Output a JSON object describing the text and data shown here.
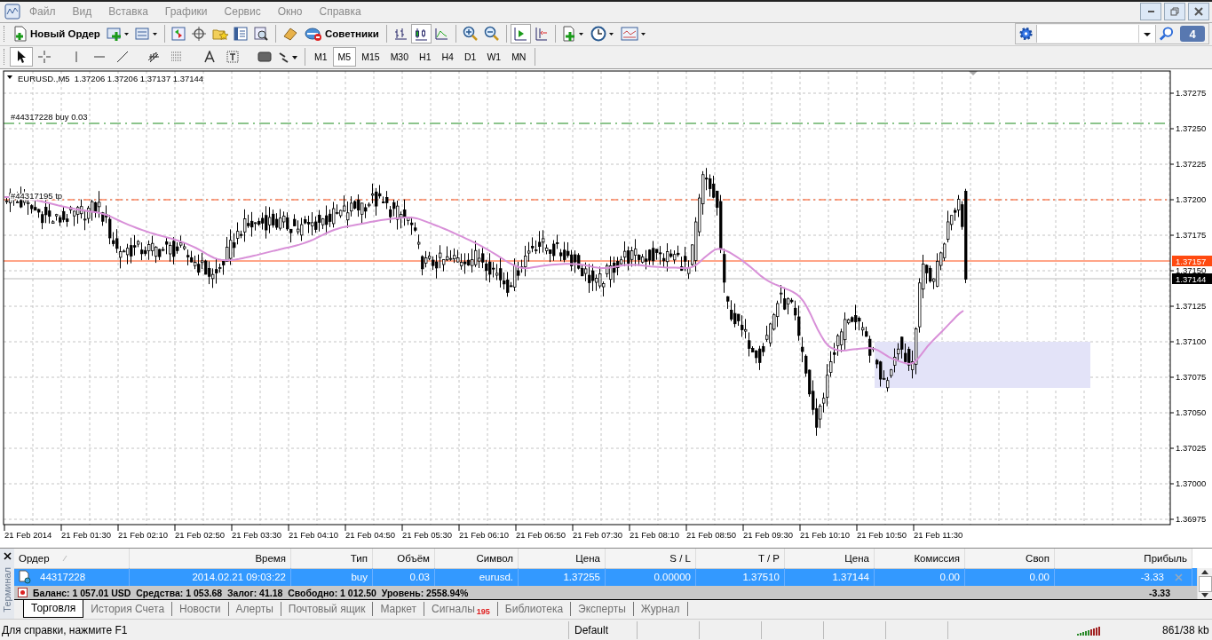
{
  "menu": [
    "Файл",
    "Вид",
    "Вставка",
    "Графики",
    "Сервис",
    "Окно",
    "Справка"
  ],
  "toolbar": {
    "new_order_label": "Новый Ордер",
    "experts_label": "Советники",
    "messages_count": "4"
  },
  "chart_types": [
    {
      "kind": "bars",
      "selected": false
    },
    {
      "kind": "candlesticks",
      "selected": true
    },
    {
      "kind": "line",
      "selected": false
    }
  ],
  "auto_scroll": {
    "on": true
  },
  "chart_shift": {
    "on": false
  },
  "tools": [
    {
      "kind": "cursor",
      "selected": true
    },
    {
      "kind": "crosshair",
      "selected": false
    },
    {
      "kind": "vertical-line",
      "selected": false
    },
    {
      "kind": "horizontal-line",
      "selected": false
    },
    {
      "kind": "trendline",
      "selected": false
    },
    {
      "kind": "channel",
      "selected": false
    },
    {
      "kind": "fibonacci",
      "selected": false
    },
    {
      "kind": "text",
      "selected": false
    },
    {
      "kind": "label",
      "selected": false
    },
    {
      "kind": "rectangle",
      "selected": false
    },
    {
      "kind": "arrows",
      "selected": false
    }
  ],
  "timeframes": [
    {
      "label": "M1",
      "selected": false
    },
    {
      "label": "M5",
      "selected": true
    },
    {
      "label": "M15",
      "selected": false
    },
    {
      "label": "M30",
      "selected": false
    },
    {
      "label": "H1",
      "selected": false
    },
    {
      "label": "H4",
      "selected": false
    },
    {
      "label": "D1",
      "selected": false
    },
    {
      "label": "W1",
      "selected": false
    },
    {
      "label": "MN",
      "selected": false
    }
  ],
  "chart": {
    "title": "EURUSD.,M5  1.37206 1.37206 1.37137 1.37144",
    "order_label": "#44317228 buy 0.03",
    "tp_label": "#44317195 tp",
    "price_axis": [
      "1.37275",
      "1.37250",
      "1.37225",
      "1.37200",
      "1.37175",
      "1.37150",
      "1.37125",
      "1.37100",
      "1.37075",
      "1.37050",
      "1.37025",
      "1.37000",
      "1.36975"
    ],
    "bid_label": "1.37157",
    "ask_label": "1.37144",
    "time_axis": [
      "21 Feb 2014",
      "21 Feb 01:30",
      "21 Feb 02:10",
      "21 Feb 02:50",
      "21 Feb 03:30",
      "21 Feb 04:10",
      "21 Feb 04:50",
      "21 Feb 05:30",
      "21 Feb 06:10",
      "21 Feb 06:50",
      "21 Feb 07:30",
      "21 Feb 08:10",
      "21 Feb 08:50",
      "21 Feb 09:30",
      "21 Feb 10:10",
      "21 Feb 10:50",
      "21 Feb 11:30"
    ]
  },
  "terminal": {
    "side_label": "Терминал",
    "columns": [
      "Ордер",
      "Время",
      "Тип",
      "Объём",
      "Символ",
      "Цена",
      "S / L",
      "T / P",
      "Цена",
      "Комиссия",
      "Своп",
      "Прибыль"
    ],
    "rows": [
      {
        "selected": true,
        "cells": [
          "44317228",
          "2014.02.21 09:03:22",
          "buy",
          "0.03",
          "eurusd.",
          "1.37255",
          "0.00000",
          "1.37510",
          "1.37144",
          "0.00",
          "0.00",
          "-3.33"
        ]
      }
    ],
    "balance": "Баланс: 1 057.01 USD  Средства: 1 053.68  Залог: 41.18  Свободно: 1 012.50  Уровень: 2558.94%",
    "total_profit": "-3.33",
    "tabs": [
      {
        "label": "Торговля",
        "selected": true
      },
      {
        "label": "История Счета",
        "selected": false
      },
      {
        "label": "Новости",
        "selected": false
      },
      {
        "label": "Алерты",
        "selected": false
      },
      {
        "label": "Почтовый ящик",
        "selected": false
      },
      {
        "label": "Маркет",
        "selected": false
      },
      {
        "label": "Сигналы",
        "badge": "195",
        "selected": false
      },
      {
        "label": "Библиотека",
        "selected": false
      },
      {
        "label": "Эксперты",
        "selected": false
      },
      {
        "label": "Журнал",
        "selected": false
      }
    ]
  },
  "status_bar": {
    "help": "Для справки, нажмите F1",
    "profile": "Default",
    "traffic": "861/38 kb"
  }
}
